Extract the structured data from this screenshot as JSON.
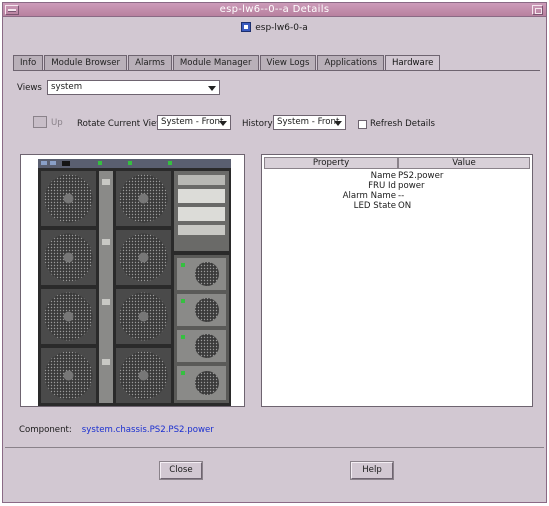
{
  "window": {
    "title": "esp-lw6--0--a Details",
    "host": "esp-lw6-0-a"
  },
  "tabs": [
    {
      "label": "Info"
    },
    {
      "label": "Module Browser"
    },
    {
      "label": "Alarms"
    },
    {
      "label": "Module Manager"
    },
    {
      "label": "View Logs"
    },
    {
      "label": "Applications"
    },
    {
      "label": "Hardware",
      "active": true
    }
  ],
  "views": {
    "label": "Views",
    "value": "system"
  },
  "toolbar": {
    "up_label": "Up",
    "rotate_label": "Rotate Current View",
    "rotate_value": "System - Front",
    "history_label": "History",
    "history_value": "System - Front",
    "refresh_label": "Refresh Details",
    "refresh_checked": false
  },
  "properties": {
    "headers": [
      "Property",
      "Value"
    ],
    "rows": [
      {
        "key": "Name",
        "value": "PS2.power"
      },
      {
        "key": "FRU Id",
        "value": "power"
      },
      {
        "key": "Alarm Name",
        "value": "--"
      },
      {
        "key": "LED State",
        "value": "ON"
      }
    ]
  },
  "component": {
    "label": "Component:",
    "path": "system.chassis.PS2.PS2.power"
  },
  "buttons": {
    "close": "Close",
    "help": "Help"
  },
  "colors": {
    "titlebar": "#cc9bb9",
    "window_bg": "#d2c8d2",
    "link": "#1a2fd0"
  }
}
